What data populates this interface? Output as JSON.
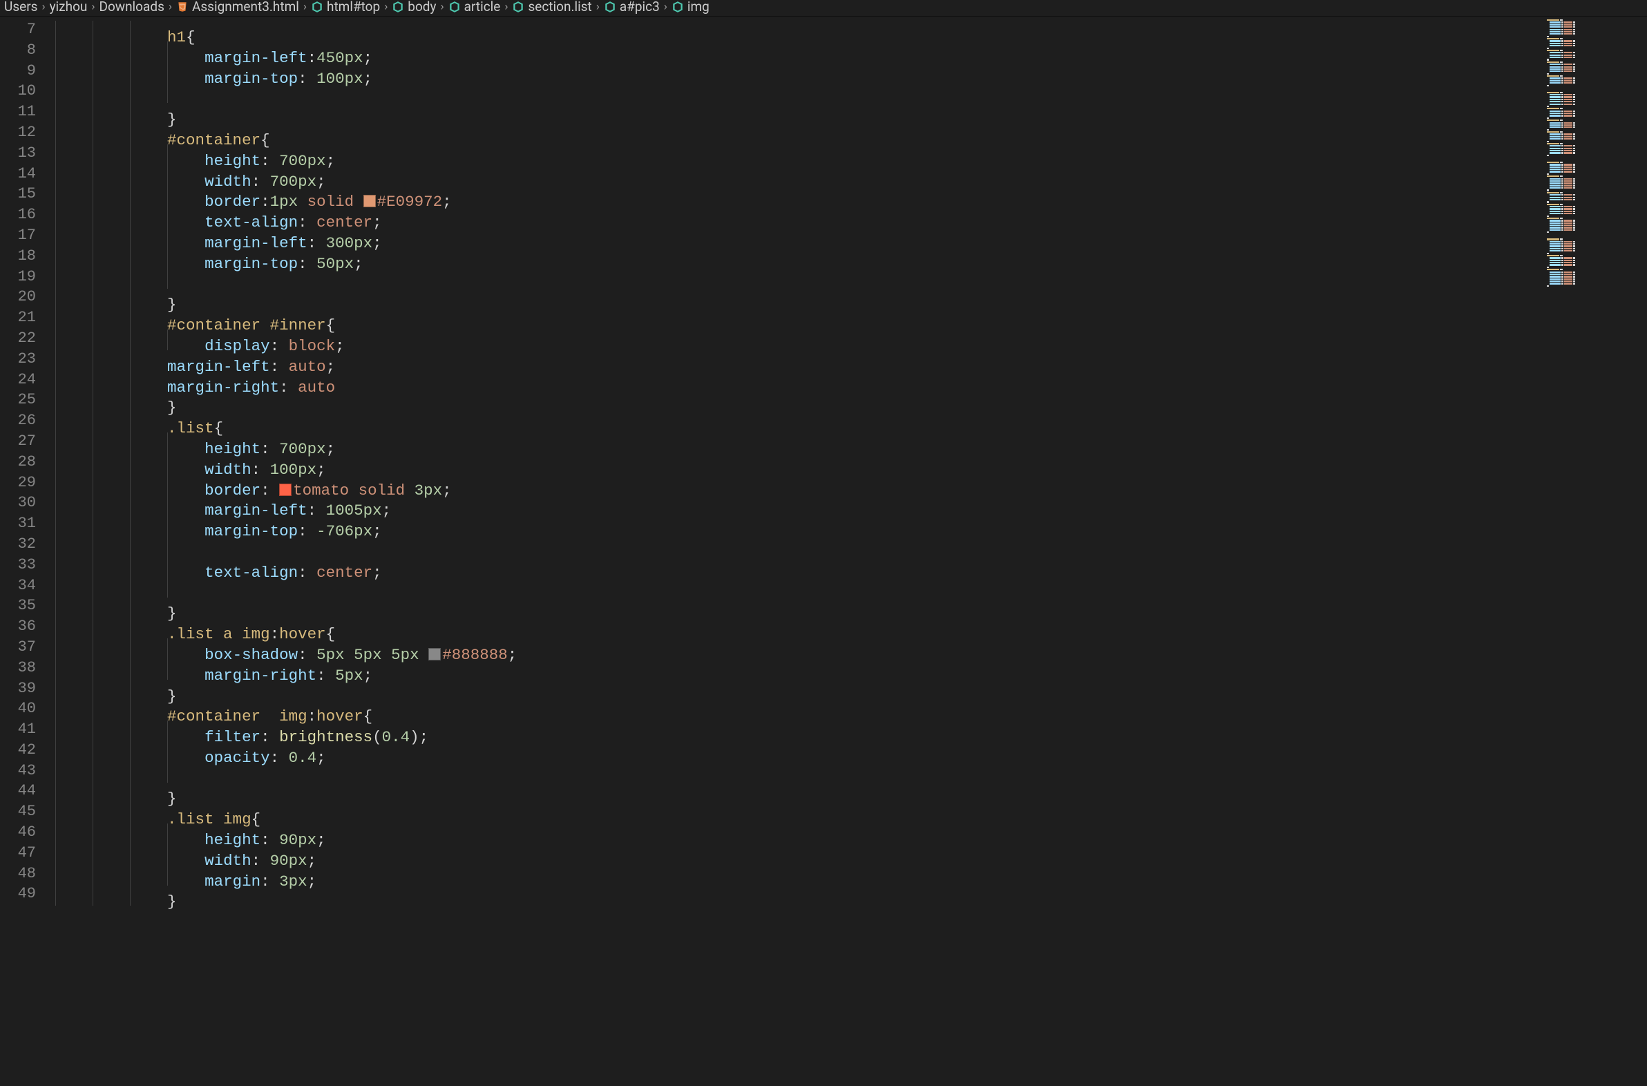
{
  "breadcrumb": {
    "path": [
      "Users",
      "yizhou",
      "Downloads"
    ],
    "file": "Assignment3.html",
    "symbols": [
      "html#top",
      "body",
      "article",
      "section.list",
      "a#pic3",
      "img"
    ]
  },
  "colors": {
    "e09972": "#E09972",
    "tomato": "#ff6347",
    "c888888": "#888888"
  },
  "lines": [
    {
      "n": 7,
      "indent": 3,
      "tokens": [
        [
          "sel",
          "h1"
        ],
        [
          "punct",
          "{"
        ]
      ]
    },
    {
      "n": 8,
      "indent": 4,
      "tokens": [
        [
          "prop",
          "margin-left"
        ],
        [
          "punct",
          ":"
        ],
        [
          "num",
          "450px"
        ],
        [
          "punct",
          ";"
        ]
      ]
    },
    {
      "n": 9,
      "indent": 4,
      "tokens": [
        [
          "prop",
          "margin-top"
        ],
        [
          "punct",
          ": "
        ],
        [
          "num",
          "100px"
        ],
        [
          "punct",
          ";"
        ]
      ]
    },
    {
      "n": 10,
      "indent": 4,
      "tokens": []
    },
    {
      "n": 11,
      "indent": 3,
      "tokens": [
        [
          "punct",
          "}"
        ]
      ]
    },
    {
      "n": 12,
      "indent": 3,
      "tokens": [
        [
          "sel",
          "#container"
        ],
        [
          "punct",
          "{"
        ]
      ]
    },
    {
      "n": 13,
      "indent": 4,
      "tokens": [
        [
          "prop",
          "height"
        ],
        [
          "punct",
          ": "
        ],
        [
          "num",
          "700px"
        ],
        [
          "punct",
          ";"
        ]
      ]
    },
    {
      "n": 14,
      "indent": 4,
      "tokens": [
        [
          "prop",
          "width"
        ],
        [
          "punct",
          ": "
        ],
        [
          "num",
          "700px"
        ],
        [
          "punct",
          ";"
        ]
      ]
    },
    {
      "n": 15,
      "indent": 4,
      "tokens": [
        [
          "prop",
          "border"
        ],
        [
          "punct",
          ":"
        ],
        [
          "num",
          "1px"
        ],
        [
          "punct",
          " "
        ],
        [
          "kw",
          "solid"
        ],
        [
          "punct",
          " "
        ],
        [
          "swatch",
          "e09972"
        ],
        [
          "kw",
          "#E09972"
        ],
        [
          "punct",
          ";"
        ]
      ]
    },
    {
      "n": 16,
      "indent": 4,
      "tokens": [
        [
          "prop",
          "text-align"
        ],
        [
          "punct",
          ": "
        ],
        [
          "kw",
          "center"
        ],
        [
          "punct",
          ";"
        ]
      ]
    },
    {
      "n": 17,
      "indent": 4,
      "tokens": [
        [
          "prop",
          "margin-left"
        ],
        [
          "punct",
          ": "
        ],
        [
          "num",
          "300px"
        ],
        [
          "punct",
          ";"
        ]
      ]
    },
    {
      "n": 18,
      "indent": 4,
      "tokens": [
        [
          "prop",
          "margin-top"
        ],
        [
          "punct",
          ": "
        ],
        [
          "num",
          "50px"
        ],
        [
          "punct",
          ";"
        ]
      ]
    },
    {
      "n": 19,
      "indent": 4,
      "tokens": []
    },
    {
      "n": 20,
      "indent": 3,
      "tokens": [
        [
          "punct",
          "}"
        ]
      ]
    },
    {
      "n": 21,
      "indent": 3,
      "tokens": [
        [
          "sel",
          "#container #inner"
        ],
        [
          "punct",
          "{"
        ]
      ]
    },
    {
      "n": 22,
      "indent": 4,
      "tokens": [
        [
          "prop",
          "display"
        ],
        [
          "punct",
          ": "
        ],
        [
          "kw",
          "block"
        ],
        [
          "punct",
          ";"
        ]
      ]
    },
    {
      "n": 23,
      "indent": 3,
      "tokens": [
        [
          "prop",
          "margin-left"
        ],
        [
          "punct",
          ": "
        ],
        [
          "kw",
          "auto"
        ],
        [
          "punct",
          ";"
        ]
      ]
    },
    {
      "n": 24,
      "indent": 3,
      "tokens": [
        [
          "prop",
          "margin-right"
        ],
        [
          "punct",
          ": "
        ],
        [
          "kw",
          "auto"
        ]
      ]
    },
    {
      "n": 25,
      "indent": 3,
      "tokens": [
        [
          "punct",
          "}"
        ]
      ]
    },
    {
      "n": 26,
      "indent": 3,
      "tokens": [
        [
          "sel",
          ".list"
        ],
        [
          "punct",
          "{"
        ]
      ]
    },
    {
      "n": 27,
      "indent": 4,
      "tokens": [
        [
          "prop",
          "height"
        ],
        [
          "punct",
          ": "
        ],
        [
          "num",
          "700px"
        ],
        [
          "punct",
          ";"
        ]
      ]
    },
    {
      "n": 28,
      "indent": 4,
      "tokens": [
        [
          "prop",
          "width"
        ],
        [
          "punct",
          ": "
        ],
        [
          "num",
          "100px"
        ],
        [
          "punct",
          ";"
        ]
      ]
    },
    {
      "n": 29,
      "indent": 4,
      "tokens": [
        [
          "prop",
          "border"
        ],
        [
          "punct",
          ": "
        ],
        [
          "swatch",
          "tomato"
        ],
        [
          "kw",
          "tomato"
        ],
        [
          "punct",
          " "
        ],
        [
          "kw",
          "solid"
        ],
        [
          "punct",
          " "
        ],
        [
          "num",
          "3px"
        ],
        [
          "punct",
          ";"
        ]
      ]
    },
    {
      "n": 30,
      "indent": 4,
      "tokens": [
        [
          "prop",
          "margin-left"
        ],
        [
          "punct",
          ": "
        ],
        [
          "num",
          "1005px"
        ],
        [
          "punct",
          ";"
        ]
      ]
    },
    {
      "n": 31,
      "indent": 4,
      "tokens": [
        [
          "prop",
          "margin-top"
        ],
        [
          "punct",
          ": "
        ],
        [
          "num",
          "-706px"
        ],
        [
          "punct",
          ";"
        ]
      ]
    },
    {
      "n": 32,
      "indent": 4,
      "tokens": []
    },
    {
      "n": 33,
      "indent": 4,
      "tokens": [
        [
          "prop",
          "text-align"
        ],
        [
          "punct",
          ": "
        ],
        [
          "kw",
          "center"
        ],
        [
          "punct",
          ";"
        ]
      ]
    },
    {
      "n": 34,
      "indent": 4,
      "tokens": []
    },
    {
      "n": 35,
      "indent": 3,
      "tokens": [
        [
          "punct",
          "}"
        ]
      ]
    },
    {
      "n": 36,
      "indent": 3,
      "tokens": [
        [
          "sel",
          ".list a img"
        ],
        [
          "punct",
          ":"
        ],
        [
          "sel",
          "hover"
        ],
        [
          "punct",
          "{"
        ]
      ]
    },
    {
      "n": 37,
      "indent": 4,
      "tokens": [
        [
          "prop",
          "box-shadow"
        ],
        [
          "punct",
          ": "
        ],
        [
          "num",
          "5px"
        ],
        [
          "punct",
          " "
        ],
        [
          "num",
          "5px"
        ],
        [
          "punct",
          " "
        ],
        [
          "num",
          "5px"
        ],
        [
          "punct",
          " "
        ],
        [
          "swatch",
          "c888888"
        ],
        [
          "kw",
          "#888888"
        ],
        [
          "punct",
          ";"
        ]
      ]
    },
    {
      "n": 38,
      "indent": 4,
      "tokens": [
        [
          "prop",
          "margin-right"
        ],
        [
          "punct",
          ": "
        ],
        [
          "num",
          "5px"
        ],
        [
          "punct",
          ";"
        ]
      ]
    },
    {
      "n": 39,
      "indent": 3,
      "tokens": [
        [
          "punct",
          "}"
        ]
      ]
    },
    {
      "n": 40,
      "indent": 3,
      "tokens": [
        [
          "sel",
          "#container  img"
        ],
        [
          "punct",
          ":"
        ],
        [
          "sel",
          "hover"
        ],
        [
          "punct",
          "{"
        ]
      ]
    },
    {
      "n": 41,
      "indent": 4,
      "tokens": [
        [
          "prop",
          "filter"
        ],
        [
          "punct",
          ": "
        ],
        [
          "func",
          "brightness"
        ],
        [
          "punct",
          "("
        ],
        [
          "num",
          "0.4"
        ],
        [
          "punct",
          ");"
        ]
      ]
    },
    {
      "n": 42,
      "indent": 4,
      "tokens": [
        [
          "prop",
          "opacity"
        ],
        [
          "punct",
          ": "
        ],
        [
          "num",
          "0.4"
        ],
        [
          "punct",
          ";"
        ]
      ]
    },
    {
      "n": 43,
      "indent": 4,
      "tokens": []
    },
    {
      "n": 44,
      "indent": 3,
      "tokens": [
        [
          "punct",
          "}"
        ]
      ]
    },
    {
      "n": 45,
      "indent": 3,
      "tokens": [
        [
          "sel",
          ".list img"
        ],
        [
          "punct",
          "{"
        ]
      ]
    },
    {
      "n": 46,
      "indent": 4,
      "tokens": [
        [
          "prop",
          "height"
        ],
        [
          "punct",
          ": "
        ],
        [
          "num",
          "90px"
        ],
        [
          "punct",
          ";"
        ]
      ]
    },
    {
      "n": 47,
      "indent": 4,
      "tokens": [
        [
          "prop",
          "width"
        ],
        [
          "punct",
          ": "
        ],
        [
          "num",
          "90px"
        ],
        [
          "punct",
          ";"
        ]
      ]
    },
    {
      "n": 48,
      "indent": 4,
      "tokens": [
        [
          "prop",
          "margin"
        ],
        [
          "punct",
          ": "
        ],
        [
          "num",
          "3px"
        ],
        [
          "punct",
          ";"
        ]
      ]
    },
    {
      "n": 49,
      "indent": 3,
      "tokens": [
        [
          "punct",
          "}"
        ]
      ]
    }
  ]
}
